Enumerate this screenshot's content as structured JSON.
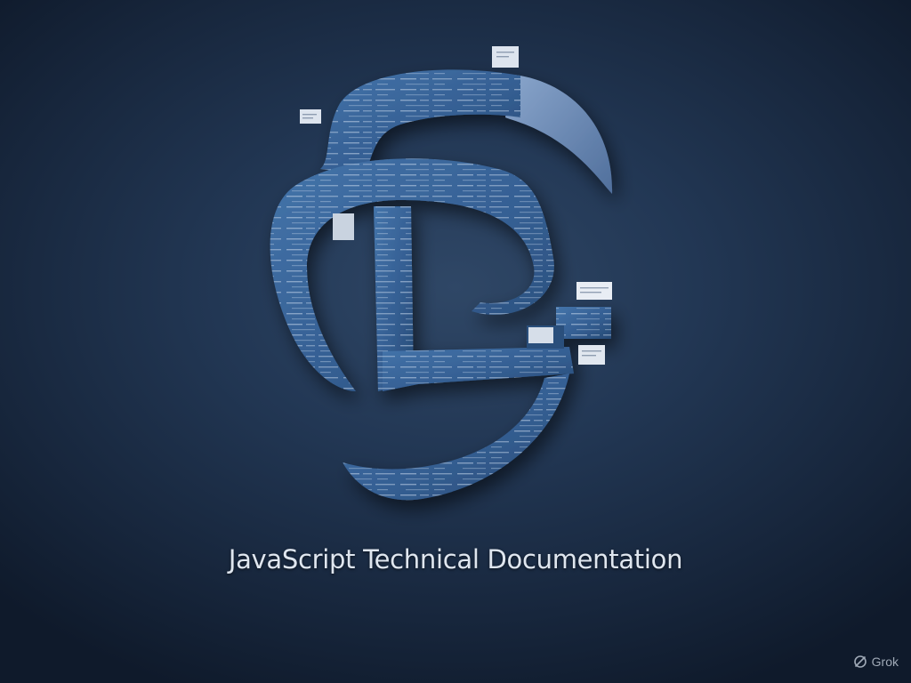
{
  "caption": "JavaScript Technical Documentation",
  "watermark": {
    "icon": "grok-logo-icon",
    "label": "Grok"
  },
  "colors": {
    "background": "#1a2a40",
    "ribbon": "#3a6497",
    "ribbon_dark": "#27486f",
    "ribbon_light": "#6d8fbe",
    "caption": "#dfe6ef"
  }
}
